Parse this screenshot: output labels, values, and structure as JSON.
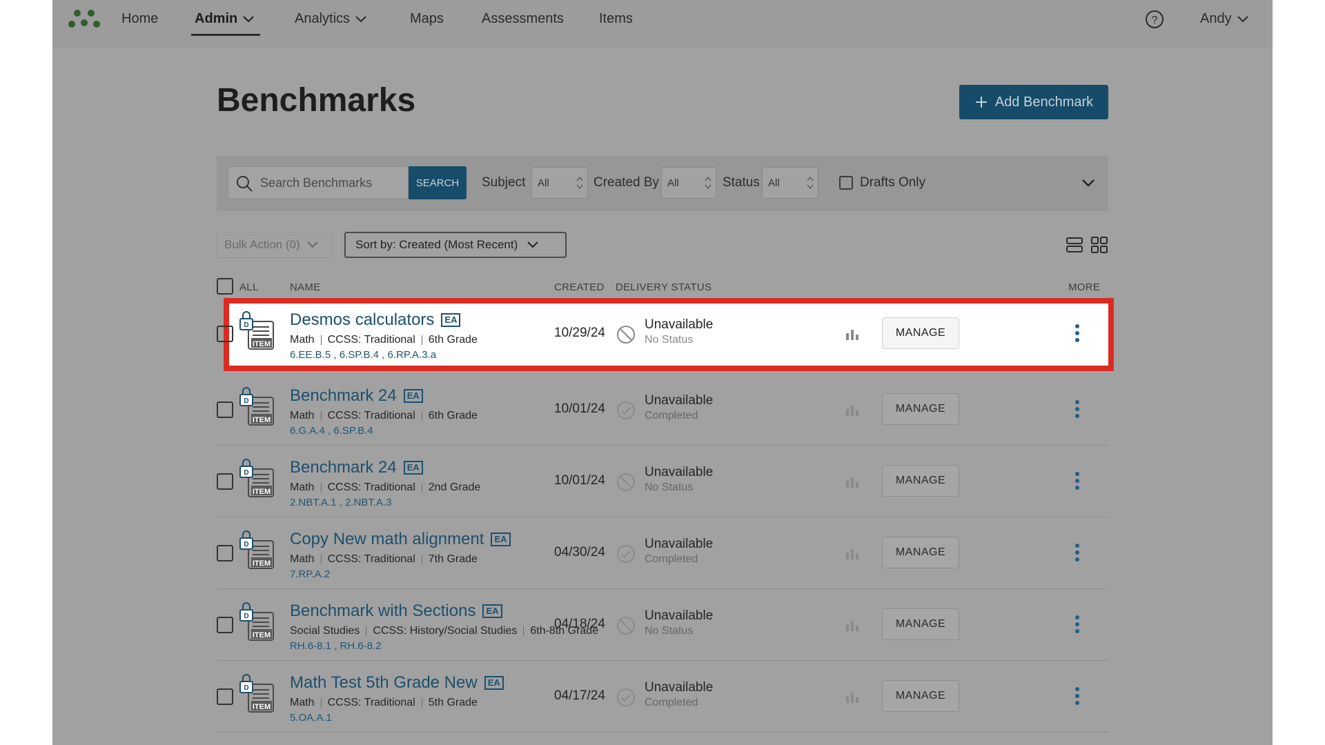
{
  "nav": {
    "items": [
      {
        "label": "Home"
      },
      {
        "label": "Admin"
      },
      {
        "label": "Analytics"
      },
      {
        "label": "Maps"
      },
      {
        "label": "Assessments"
      },
      {
        "label": "Items"
      }
    ],
    "user": "Andy"
  },
  "page": {
    "title": "Benchmarks",
    "add_button": "Add Benchmark"
  },
  "filters": {
    "search_placeholder": "Search Benchmarks",
    "search_button": "SEARCH",
    "subject_label": "Subject",
    "subject_value": "All",
    "created_by_label": "Created By",
    "created_by_value": "All",
    "status_label": "Status",
    "status_value": "All",
    "drafts_label": "Drafts Only"
  },
  "toolbar": {
    "bulk_action": "Bulk Action (0)",
    "sort": "Sort by: Created (Most Recent)"
  },
  "table": {
    "headers": {
      "all": "ALL",
      "name": "NAME",
      "created": "CREATED",
      "delivery": "DELIVERY STATUS",
      "more": "MORE"
    },
    "manage_label": "MANAGE",
    "badge": "EA",
    "rows": [
      {
        "title": "Desmos calculators",
        "subject": "Math",
        "standard": "CCSS: Traditional",
        "grade": "6th Grade",
        "codes": "6.EE.B.5 , 6.SP.B.4 , 6.RP.A.3.a",
        "created": "10/29/24",
        "status": "Unavailable",
        "substatus": "No Status",
        "status_icon": "blocked-icon"
      },
      {
        "title": "Benchmark 24",
        "subject": "Math",
        "standard": "CCSS: Traditional",
        "grade": "6th Grade",
        "codes": "6.G.A.4 , 6.SP.B.4",
        "created": "10/01/24",
        "status": "Unavailable",
        "substatus": "Completed",
        "status_icon": "check-circle-icon"
      },
      {
        "title": "Benchmark 24",
        "subject": "Math",
        "standard": "CCSS: Traditional",
        "grade": "2nd Grade",
        "codes": "2.NBT.A.1 , 2.NBT.A.3",
        "created": "10/01/24",
        "status": "Unavailable",
        "substatus": "No Status",
        "status_icon": "blocked-icon"
      },
      {
        "title": "Copy New math alignment",
        "subject": "Math",
        "standard": "CCSS: Traditional",
        "grade": "7th Grade",
        "codes": "7.RP.A.2",
        "created": "04/30/24",
        "status": "Unavailable",
        "substatus": "Completed",
        "status_icon": "check-circle-icon"
      },
      {
        "title": "Benchmark with Sections",
        "subject": "Social Studies",
        "standard": "CCSS: History/Social Studies",
        "grade": "6th-8th Grade",
        "codes": "RH.6-8.1 , RH.6-8.2",
        "created": "04/18/24",
        "status": "Unavailable",
        "substatus": "No Status",
        "status_icon": "blocked-icon"
      },
      {
        "title": "Math Test 5th Grade New",
        "subject": "Math",
        "standard": "CCSS: Traditional",
        "grade": "5th Grade",
        "codes": "5.OA.A.1",
        "created": "04/17/24",
        "status": "Unavailable",
        "substatus": "Completed",
        "status_icon": "check-circle-icon"
      }
    ]
  },
  "colors": {
    "primary": "#164b6a",
    "highlight": "#dc2a22",
    "link": "#1c4f6e"
  }
}
